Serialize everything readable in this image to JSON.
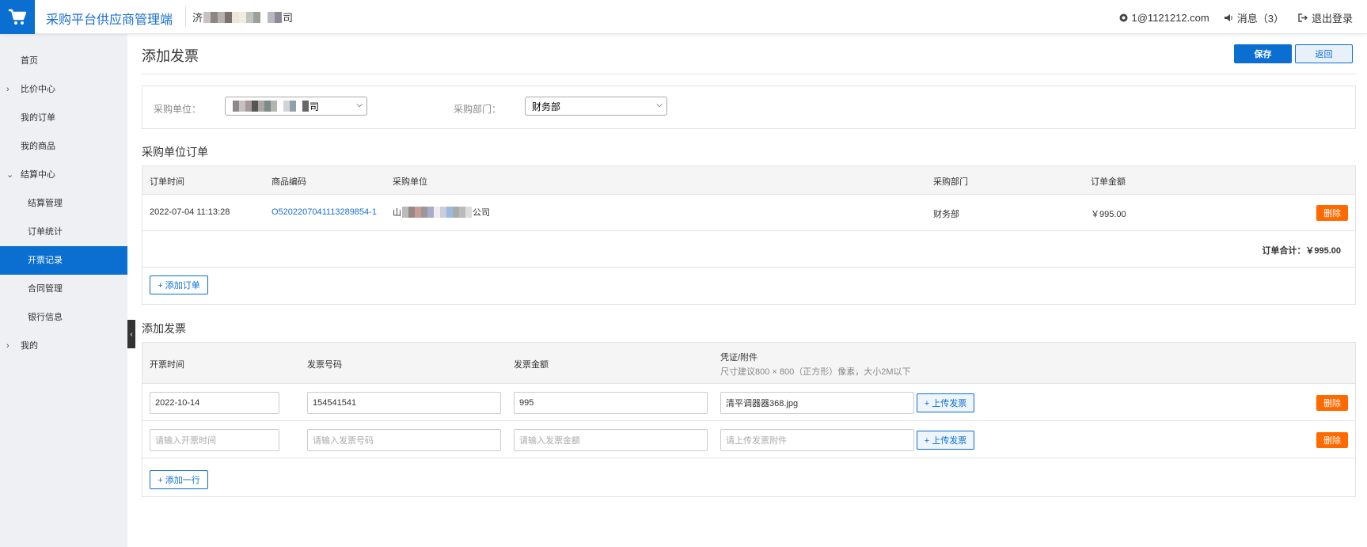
{
  "header": {
    "app_title": "采购平台供应商管理端",
    "company_prefix": "济",
    "company_suffix": "司",
    "email": "1@1121212.com",
    "messages": "消息（3）",
    "logout": "退出登录"
  },
  "sidebar": {
    "items": [
      {
        "label": "首页"
      },
      {
        "label": "比价中心"
      },
      {
        "label": "我的订单"
      },
      {
        "label": "我的商品"
      },
      {
        "label": "结算中心"
      },
      {
        "label": "结算管理"
      },
      {
        "label": "订单统计"
      },
      {
        "label": "开票记录"
      },
      {
        "label": "合同管理"
      },
      {
        "label": "银行信息"
      },
      {
        "label": "我的"
      }
    ],
    "collapse_glyph": "‹"
  },
  "page": {
    "title": "添加发票",
    "save_label": "保存",
    "back_label": "返回"
  },
  "filters": {
    "unit_label": "采购单位：",
    "unit_value_suffix": "司",
    "dept_label": "采购部门：",
    "dept_value": "财务部"
  },
  "orders": {
    "section_title": "采购单位订单",
    "headers": [
      "订单时间",
      "商品编码",
      "采购单位",
      "采购部门",
      "订单金额"
    ],
    "rows": [
      {
        "time": "2022-07-04 11:13:28",
        "code": "O5202207041113289854-1",
        "unit_prefix": "山",
        "unit_suffix": "公司",
        "dept": "财务部",
        "amount": "￥995.00",
        "delete_label": "删除"
      }
    ],
    "total_label": "订单合计：￥995.00",
    "add_label": "+ 添加订单"
  },
  "invoices": {
    "section_title": "添加发票",
    "headers": [
      "开票时间",
      "发票号码",
      "发票金额",
      "凭证/附件"
    ],
    "attachment_hint": "尺寸建议800 × 800（正方形）像素，大小2M以下",
    "rows": [
      {
        "date": "2022-10-14",
        "number": "154541541",
        "amount": "995",
        "file": "清平调器器368.jpg",
        "upload_label": "+ 上传发票",
        "delete_label": "删除"
      },
      {
        "date_placeholder": "请输入开票时间",
        "number_placeholder": "请输入发票号码",
        "amount_placeholder": "请输入发票金额",
        "file_placeholder": "请上传发票附件",
        "upload_label": "+ 上传发票",
        "delete_label": "删除"
      }
    ],
    "add_row_label": "+ 添加一行"
  },
  "colors": {
    "primary": "#0a6fd1",
    "danger": "#ff6a00",
    "sidebar_bg": "#eef0f3"
  }
}
